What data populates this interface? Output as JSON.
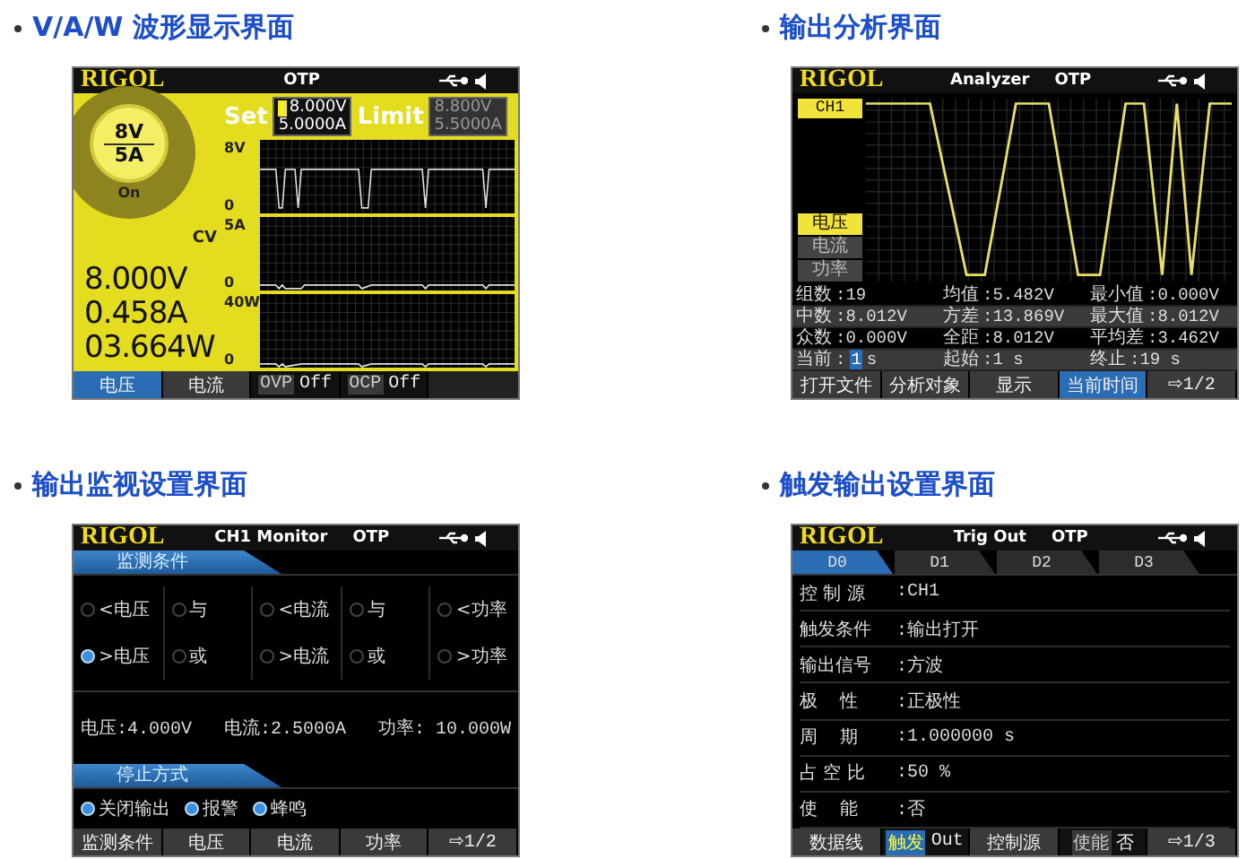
{
  "sections": [
    {
      "kind": "waveform",
      "heading": "V/A/W 波形显示界面",
      "screen": {
        "logo": "RIGOL",
        "status": "OTP",
        "dial": {
          "voltage": "8V",
          "current": "5A",
          "state": "On"
        },
        "set": {
          "label": "Set",
          "voltage": "8.000V",
          "current": "5.0000A"
        },
        "limit": {
          "label": "Limit",
          "voltage": "8.800V",
          "current": "5.5000A"
        },
        "mode": "CV",
        "panels": [
          {
            "max": "8V",
            "min": "0",
            "kind": "voltage"
          },
          {
            "max": "5A",
            "min": "0",
            "kind": "current"
          },
          {
            "max": "40W",
            "min": "0",
            "kind": "power"
          }
        ],
        "readings": [
          "8.000V",
          "0.458A",
          "03.664W"
        ],
        "softkeys": [
          {
            "label": "电压",
            "selected": true
          },
          {
            "label": "电流",
            "selected": false
          },
          {
            "label": "OVP",
            "value": "Off",
            "selected": false
          },
          {
            "label": "OCP",
            "value": "Off",
            "selected": false
          }
        ]
      }
    },
    {
      "kind": "analyzer",
      "heading": "输出分析界面",
      "screen": {
        "logo": "RIGOL",
        "title": "Analyzer",
        "status": "OTP",
        "channel": "CH1",
        "targets": [
          {
            "label": "电压",
            "selected": true
          },
          {
            "label": "电流",
            "selected": false
          },
          {
            "label": "功率",
            "selected": false
          }
        ],
        "stats": [
          [
            {
              "label": "组数",
              "value": ":19"
            },
            {
              "label": "均值",
              "value": ":5.482V"
            },
            {
              "label": "最小值",
              "value": ":0.000V"
            }
          ],
          [
            {
              "label": "中数",
              "value": ":8.012V"
            },
            {
              "label": "方差",
              "value": ":13.869V"
            },
            {
              "label": "最大值",
              "value": ":8.012V"
            }
          ],
          [
            {
              "label": "众数",
              "value": ":0.000V"
            },
            {
              "label": "全距",
              "value": ":8.012V"
            },
            {
              "label": "平均差",
              "value": ":3.462V"
            }
          ],
          [
            {
              "label": "当前",
              "value": ":",
              "cursor": "1",
              "unit": "s"
            },
            {
              "label": "起始",
              "value": ":1 s"
            },
            {
              "label": "终止",
              "value": ":19 s"
            }
          ]
        ],
        "softkeys": [
          {
            "label": "打开文件",
            "selected": false
          },
          {
            "label": "分析对象",
            "selected": false
          },
          {
            "label": "显示",
            "selected": false
          },
          {
            "label": "当前时间",
            "selected": true
          },
          {
            "label": "⇨1/2",
            "selected": false
          }
        ]
      }
    },
    {
      "kind": "monitor",
      "heading": "输出监视设置界面",
      "screen": {
        "logo": "RIGOL",
        "title": "CH1 Monitor",
        "status": "OTP",
        "condition_tab": "监测条件",
        "conditions": [
          [
            {
              "label": "<电压",
              "checked": false
            },
            {
              "label": "与",
              "checked": false
            },
            {
              "label": "<电流",
              "checked": false
            },
            {
              "label": "与",
              "checked": false
            },
            {
              "label": "<功率",
              "checked": false
            }
          ],
          [
            {
              "label": ">电压",
              "checked": true
            },
            {
              "label": "或",
              "checked": false
            },
            {
              "label": ">电流",
              "checked": false
            },
            {
              "label": "或",
              "checked": false
            },
            {
              "label": ">功率",
              "checked": false
            }
          ]
        ],
        "values": [
          "电压:4.000V",
          "电流:2.5000A",
          "功率: 10.000W"
        ],
        "stop_tab": "停止方式",
        "stop_actions": [
          {
            "label": "关闭输出",
            "checked": true
          },
          {
            "label": "报警",
            "checked": true
          },
          {
            "label": "蜂鸣",
            "checked": true
          }
        ],
        "softkeys": [
          {
            "label": "监测条件",
            "selected": false
          },
          {
            "label": "电压",
            "selected": false
          },
          {
            "label": "电流",
            "selected": false
          },
          {
            "label": "功率",
            "selected": false
          },
          {
            "label": "⇨1/2",
            "selected": false
          }
        ]
      }
    },
    {
      "kind": "trigger",
      "heading": "触发输出设置界面",
      "screen": {
        "logo": "RIGOL",
        "title": "Trig Out",
        "status": "OTP",
        "tabs": [
          {
            "label": "D0",
            "selected": true
          },
          {
            "label": "D1",
            "selected": false
          },
          {
            "label": "D2",
            "selected": false
          },
          {
            "label": "D3",
            "selected": false
          }
        ],
        "fields": [
          {
            "label": "控 制 源",
            "value": ":CH1"
          },
          {
            "label": "触发条件",
            "value": ":输出打开"
          },
          {
            "label": "输出信号",
            "value": ":方波"
          },
          {
            "label": "极    性",
            "value": ":正极性"
          },
          {
            "label": "周    期",
            "value": ":1.000000 s"
          },
          {
            "label": "占 空 比",
            "value": ":50 %"
          },
          {
            "label": "使    能",
            "value": ":否"
          }
        ],
        "softkeys": [
          {
            "label": "数据线",
            "selected": false
          },
          {
            "label": "触发",
            "value": "Out",
            "selected": true
          },
          {
            "label": "控制源",
            "selected": false
          },
          {
            "label": "使能",
            "value": "否",
            "selected": false
          },
          {
            "label": "⇨1/3",
            "selected": false
          }
        ]
      }
    }
  ]
}
